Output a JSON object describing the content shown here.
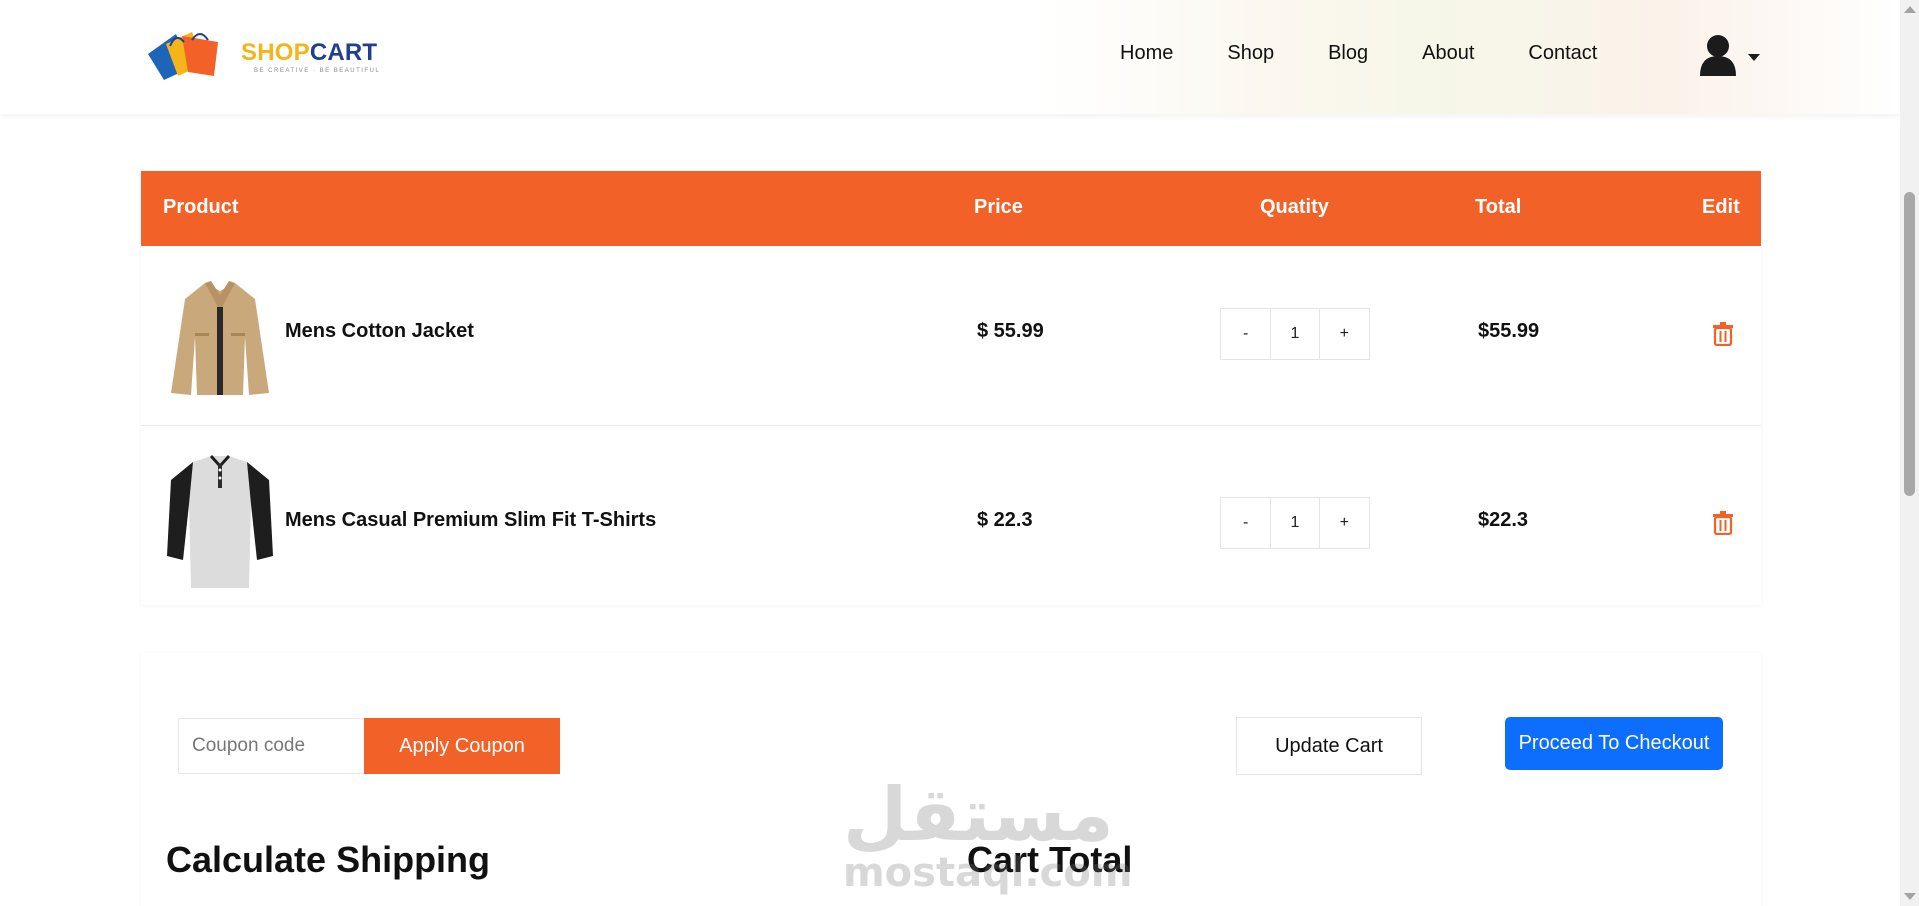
{
  "brand": {
    "shop": "SHOP",
    "cart": "CART",
    "tagline": "BE CREATIVE · BE BEAUTIFUL"
  },
  "nav": {
    "items": [
      "Home",
      "Shop",
      "Blog",
      "About",
      "Contact"
    ]
  },
  "table": {
    "headers": {
      "product": "Product",
      "price": "Price",
      "quantity": "Quatity",
      "total": "Total",
      "edit": "Edit"
    },
    "rows": [
      {
        "name": "Mens Cotton Jacket",
        "price": "$ 55.99",
        "qty_minus": "-",
        "qty": "1",
        "qty_plus": "+",
        "total": "$55.99"
      },
      {
        "name": "Mens Casual Premium Slim Fit T-Shirts",
        "price": "$ 22.3",
        "qty_minus": "-",
        "qty": "1",
        "qty_plus": "+",
        "total": "$22.3"
      }
    ]
  },
  "actions": {
    "coupon_placeholder": "Coupon code",
    "apply_coupon": "Apply Coupon",
    "update_cart": "Update Cart",
    "checkout": "Proceed To Checkout"
  },
  "sections": {
    "shipping": "Calculate Shipping",
    "cart_total": "Cart Total"
  },
  "watermark": {
    "arabic": "مستقل",
    "latin": "mostaql.com"
  },
  "colors": {
    "accent": "#f26127",
    "primary": "#0d6efd"
  }
}
